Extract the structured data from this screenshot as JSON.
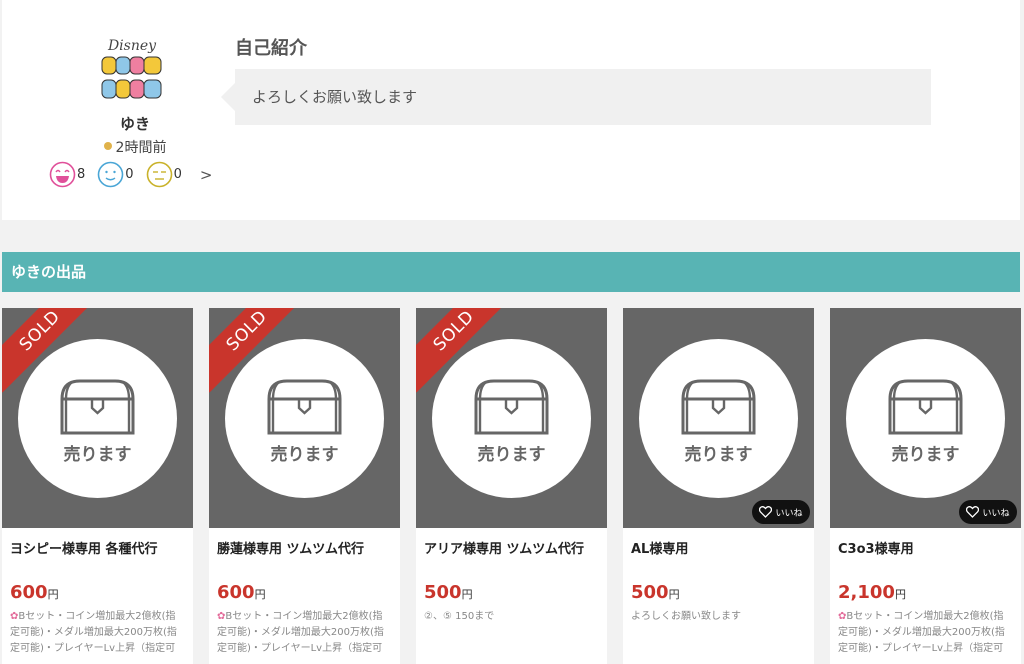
{
  "profile": {
    "avatar_icon": "disney-tsum-tsum-logo",
    "username": "ゆき",
    "last_seen": "2時間前",
    "ratings": [
      {
        "icon": "good-face-icon",
        "count": "8",
        "color": "#e0509a"
      },
      {
        "icon": "normal-face-icon",
        "count": "0",
        "color": "#4aa6d6"
      },
      {
        "icon": "bad-face-icon",
        "count": "0",
        "color": "#c9b22a"
      }
    ],
    "more_label": ">"
  },
  "intro": {
    "title": "自己紹介",
    "text": "よろしくお願い致します"
  },
  "listing": {
    "header": "ゆきの出品",
    "items": [
      {
        "image_label": "売ります",
        "sold": true,
        "sold_label": "SOLD",
        "liked": false,
        "title": "ヨシピー様専用 各種代行",
        "price": "600",
        "currency": "円",
        "desc_icon": "flower-icon",
        "description": "Bセット・コイン増加最大2億枚(指定可能)・メダル増加最大200万枚(指定可能)・プレイヤーLv上昇（指定可"
      },
      {
        "image_label": "売ります",
        "sold": true,
        "sold_label": "SOLD",
        "liked": false,
        "title": "勝蓮様専用 ツムツム代行",
        "price": "600",
        "currency": "円",
        "desc_icon": "flower-icon",
        "description": "Bセット・コイン増加最大2億枚(指定可能)・メダル増加最大200万枚(指定可能)・プレイヤーLv上昇（指定可"
      },
      {
        "image_label": "売ります",
        "sold": true,
        "sold_label": "SOLD",
        "liked": false,
        "title": "アリア様専用 ツムツム代行",
        "price": "500",
        "currency": "円",
        "desc_icon": "",
        "description": "②、⑤ 150まで"
      },
      {
        "image_label": "売ります",
        "sold": false,
        "sold_label": "",
        "liked": true,
        "like_label": "いいね",
        "title": "AL様専用",
        "price": "500",
        "currency": "円",
        "desc_icon": "",
        "description": "よろしくお願い致します"
      },
      {
        "image_label": "売ります",
        "sold": false,
        "sold_label": "",
        "liked": true,
        "like_label": "いいね",
        "title": "C3o3様専用",
        "price": "2,100",
        "currency": "円",
        "desc_icon": "flower-icon",
        "description": "Bセット・コイン増加最大2億枚(指定可能)・メダル増加最大200万枚(指定可能)・プレイヤーLv上昇（指定可"
      }
    ]
  }
}
